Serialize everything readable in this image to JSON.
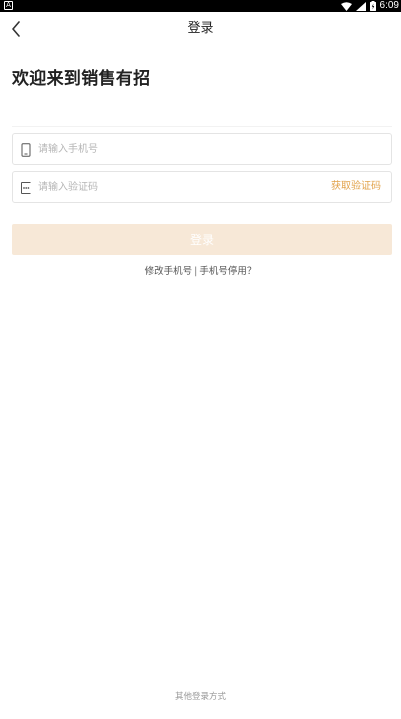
{
  "status_bar": {
    "left_icon": "A",
    "time": "6:09",
    "icons": [
      "wifi-icon",
      "signal-icon",
      "battery-icon"
    ]
  },
  "nav": {
    "back_icon": "chevron-left-icon",
    "title": "登录"
  },
  "welcome_title": "欢迎来到销售有招",
  "form": {
    "phone_placeholder": "请输入手机号",
    "phone_value": "",
    "code_placeholder": "请输入验证码",
    "code_value": "",
    "get_code_label": "获取验证码",
    "submit_label": "登录"
  },
  "links": {
    "change_phone": "修改手机号",
    "separator": "|",
    "phone_disabled": "手机号停用？"
  },
  "other_login": "其他登录方式",
  "colors": {
    "accent": "#e2a24a",
    "button_disabled_bg": "#f7e8d7",
    "status_bar_bg": "#000000"
  }
}
